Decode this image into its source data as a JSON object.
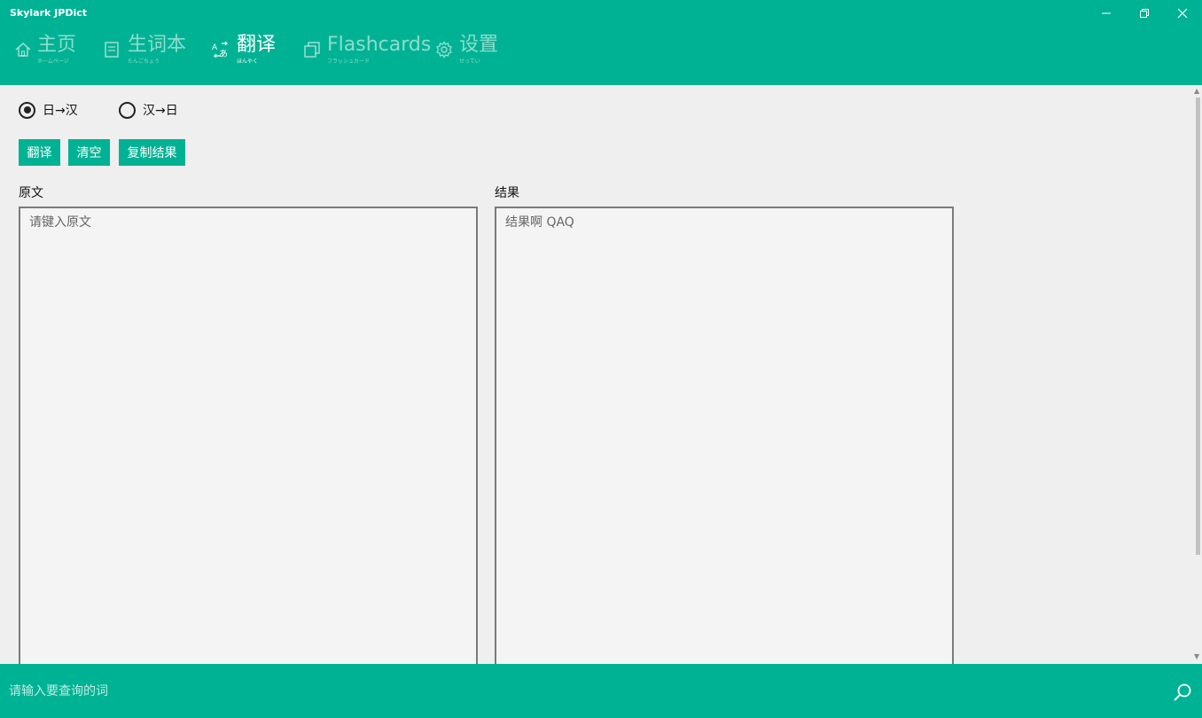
{
  "app": {
    "title": "Skylark JPDict"
  },
  "nav": [
    {
      "label": "主页",
      "sub": "ホームページ",
      "icon": "home-icon",
      "active": false
    },
    {
      "label": "生词本",
      "sub": "たんごちょう",
      "icon": "notebook-icon",
      "active": false
    },
    {
      "label": "翻译",
      "sub": "ほんやく",
      "icon": "translate-icon",
      "active": true
    },
    {
      "label": "Flashcards",
      "sub": "フラッシュカード",
      "icon": "cards-icon",
      "active": false
    },
    {
      "label": "设置",
      "sub": "せってい",
      "icon": "gear-icon",
      "active": false
    }
  ],
  "direction": {
    "options": [
      "日→汉",
      "汉→日"
    ],
    "selected": "日→汉"
  },
  "actions": {
    "translate": "翻译",
    "clear": "清空",
    "copy": "复制结果"
  },
  "source": {
    "label": "原文",
    "placeholder": "请键入原文"
  },
  "result": {
    "label": "结果",
    "placeholder": "结果啊 QAQ"
  },
  "search": {
    "placeholder": "请输入要查询的词"
  },
  "colors": {
    "accent": "#00b294",
    "background": "#efefef"
  }
}
